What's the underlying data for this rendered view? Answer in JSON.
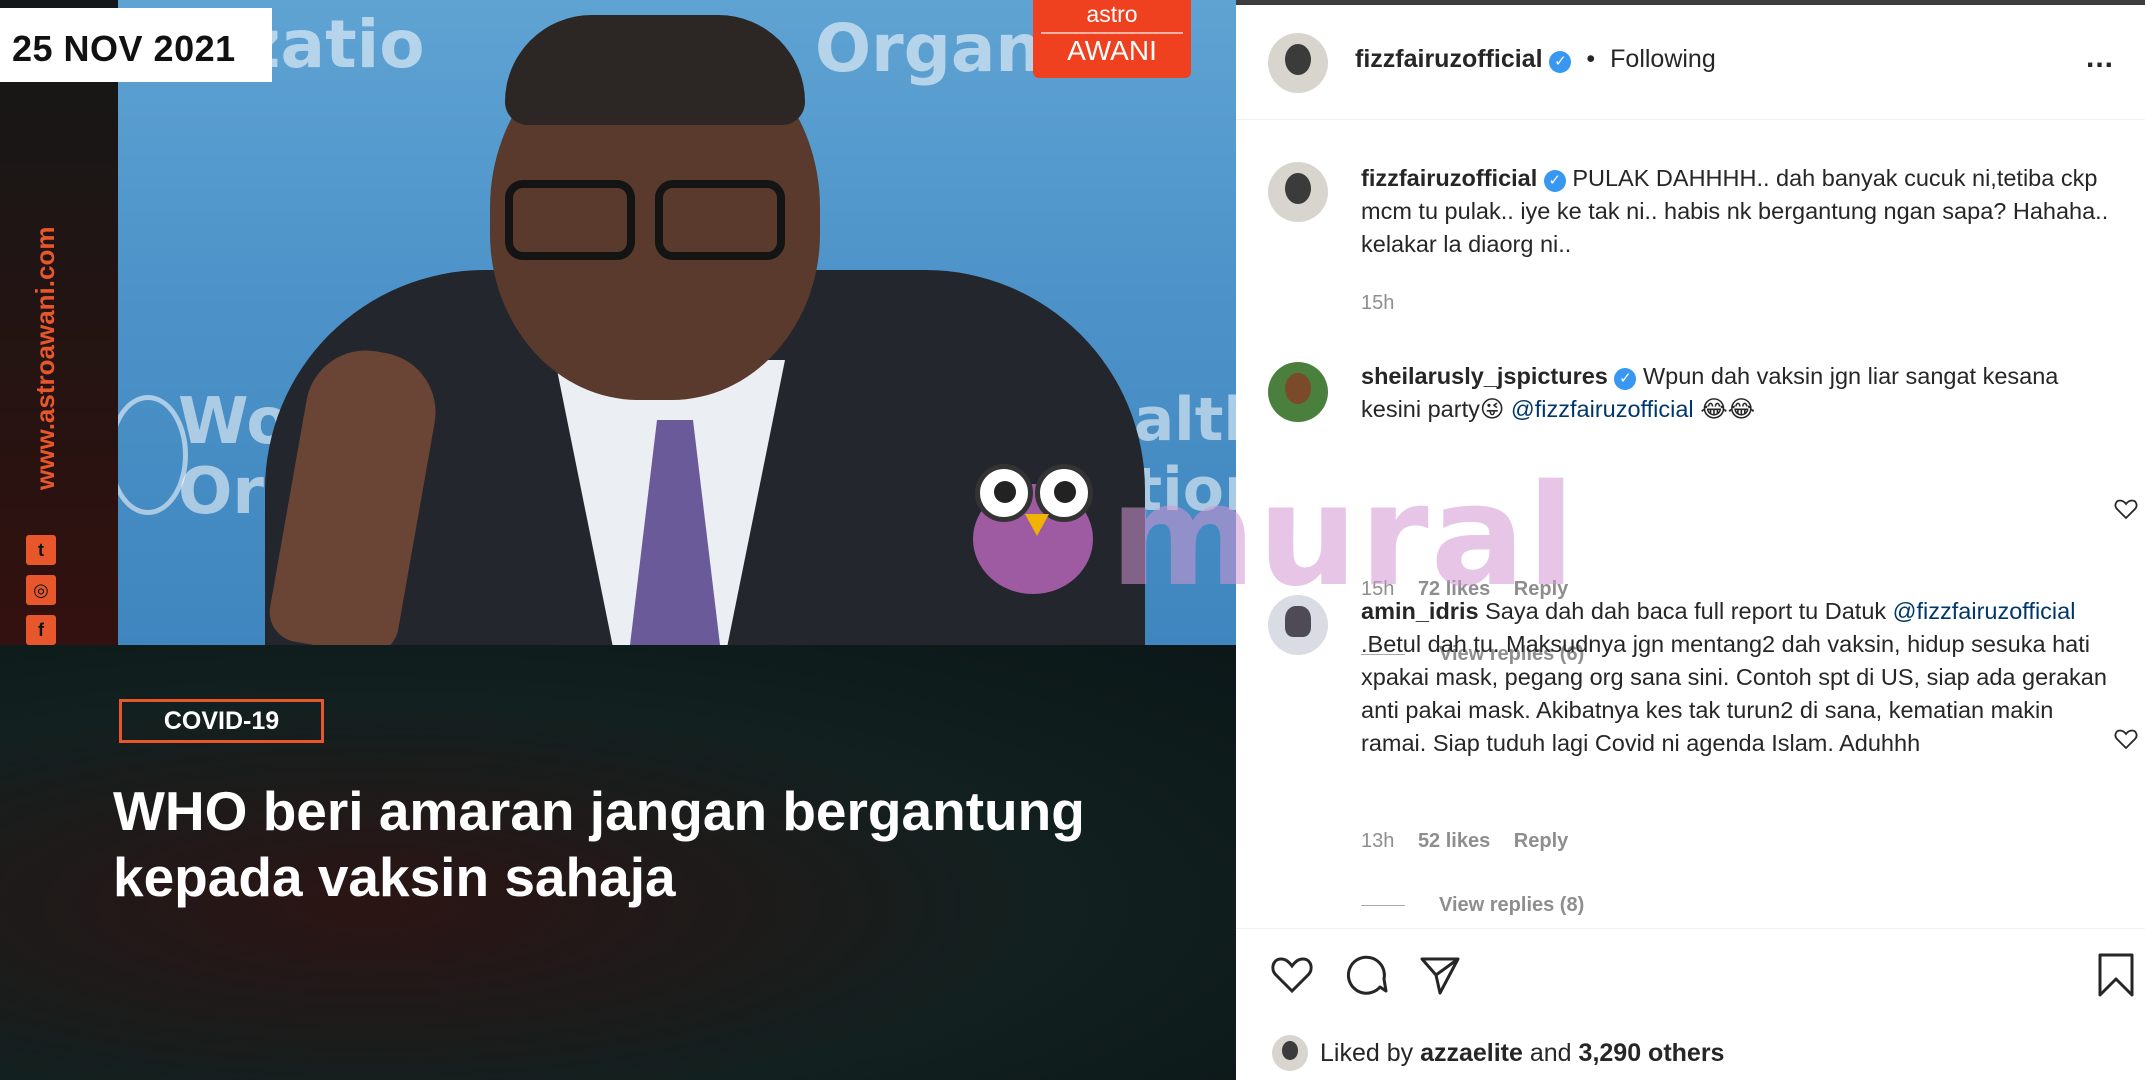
{
  "image": {
    "date_badge": "25 NOV 2021",
    "astro_logo": {
      "line1": "astro",
      "line2": "AWANI"
    },
    "vertical_url": "www.astroawani.com",
    "background_words": [
      "anizatio",
      "Organ",
      "Wor",
      "Org",
      "ealth",
      "ation"
    ],
    "tag": "COVID-19",
    "headline_line1": "WHO beri amaran jangan bergantung",
    "headline_line2": "kepada vaksin sahaja",
    "social_icons": [
      "twitter-icon",
      "instagram-icon",
      "facebook-icon"
    ],
    "watermark": "mural",
    "accent_color": "#e8572c"
  },
  "header": {
    "username": "fizzfairuzofficial",
    "verified": true,
    "separator": "•",
    "follow_status": "Following",
    "more": "..."
  },
  "comments": [
    {
      "username": "fizzfairuzofficial",
      "verified": true,
      "text": "PULAK DAHHHH.. dah banyak cucuk ni,tetiba ckp mcm tu pulak.. iye ke tak ni.. habis nk bergantung ngan sapa? Hahaha.. kelakar la diaorg ni..",
      "time": "15h"
    },
    {
      "username": "sheilarusly_jspictures",
      "verified": true,
      "text_before": "Wpun dah vaksin jgn liar sangat kesana kesini party😜",
      "mention": "@fizzfairuzofficial",
      "text_after": "😂😂",
      "time": "15h",
      "likes": "72 likes",
      "reply": "Reply",
      "view_replies": "View replies (6)"
    },
    {
      "username": "amin_idris",
      "verified": false,
      "text_before": "Saya dah dah baca full report tu Datuk",
      "mention": "@fizzfairuzofficial",
      "text_after": ".Betul dah tu. Maksudnya jgn mentang2 dah vaksin, hidup sesuka hati xpakai mask, pegang org sana sini. Contoh spt di US, siap ada gerakan anti pakai mask. Akibatnya kes tak turun2 di sana, kematian makin ramai. Siap tuduh lagi Covid ni agenda Islam. Aduhhh",
      "time": "13h",
      "likes": "52 likes",
      "reply": "Reply",
      "view_replies": "View replies (8)"
    }
  ],
  "footer": {
    "liked_prefix": "Liked by",
    "liked_user": "azzaelite",
    "liked_and": "and",
    "liked_others": "3,290 others"
  },
  "colors": {
    "verified": "#3897f0",
    "mention": "#00376b",
    "muted": "#8e8e8e"
  }
}
